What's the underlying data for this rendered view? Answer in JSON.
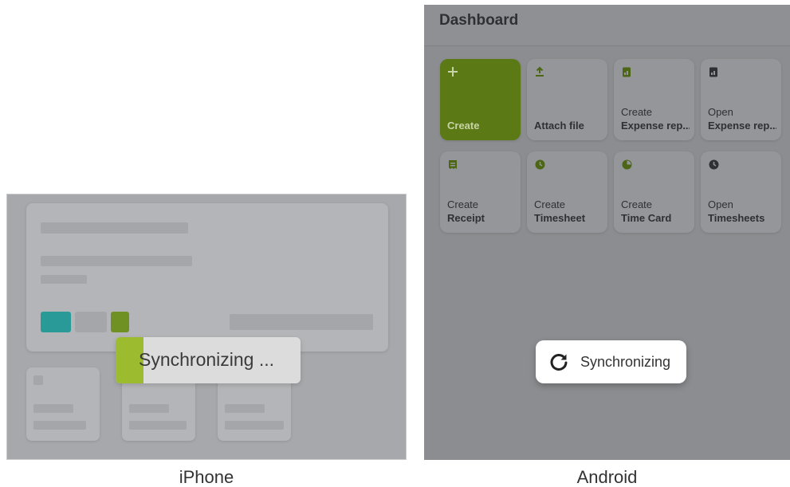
{
  "iphone": {
    "caption": "iPhone",
    "toast": {
      "label": "Synchronizing ...",
      "progress_fraction": 0.15
    },
    "colors": {
      "accent_progress": "#9dbb2f",
      "chip_teal": "#2a9a98",
      "chip_green": "#6f9124"
    }
  },
  "android": {
    "caption": "Android",
    "header": {
      "title": "Dashboard"
    },
    "tiles": [
      {
        "line1": "",
        "line2": "Create",
        "icon": "plus-icon"
      },
      {
        "line1": "",
        "line2": "Attach file",
        "icon": "upload-icon"
      },
      {
        "line1": "Create",
        "line2": "Expense rep...",
        "icon": "expense-report-icon"
      },
      {
        "line1": "Open",
        "line2": "Expense rep...",
        "icon": "expense-report-icon"
      },
      {
        "line1": "Create",
        "line2": "Receipt",
        "icon": "receipt-icon"
      },
      {
        "line1": "Create",
        "line2": "Timesheet",
        "icon": "clock-icon"
      },
      {
        "line1": "Create",
        "line2": "Time Card",
        "icon": "pie-clock-icon"
      },
      {
        "line1": "Open",
        "line2": "Timesheets",
        "icon": "clock-icon"
      }
    ],
    "toast": {
      "label": "Synchronizing",
      "icon": "refresh-icon"
    },
    "colors": {
      "accent": "#5b7a16",
      "icon": "#4c6616"
    }
  }
}
